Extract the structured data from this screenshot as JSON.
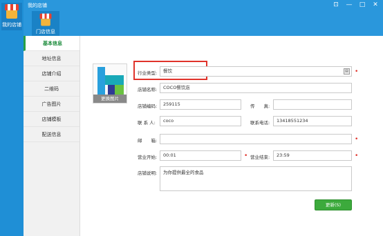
{
  "app": {
    "title": "我的店铺"
  },
  "rail": {
    "label": "我的店铺"
  },
  "window_controls": [
    "⊡",
    "—",
    "□",
    "✕"
  ],
  "tab": {
    "label": "门店信息"
  },
  "nav": {
    "items": [
      {
        "label": "基本信息",
        "active": true
      },
      {
        "label": "地址信息",
        "active": false
      },
      {
        "label": "店铺介绍",
        "active": false
      },
      {
        "label": "二维码",
        "active": false
      },
      {
        "label": "广告图片",
        "active": false
      },
      {
        "label": "店铺模板",
        "active": false
      },
      {
        "label": "配送信息",
        "active": false
      }
    ]
  },
  "logo": {
    "caption": "更换图片"
  },
  "form": {
    "industry": {
      "label": "行业类型:",
      "value": "餐饮"
    },
    "store_name": {
      "label": "店铺名称:",
      "value": "COCO餐饮店"
    },
    "store_code": {
      "label": "店铺编码:",
      "value": "259115"
    },
    "fax": {
      "label": "传　　真:",
      "value": ""
    },
    "contact": {
      "label": "联 系 人:",
      "value": "coco"
    },
    "phone": {
      "label": "联系电话:",
      "value": "13418551234"
    },
    "email": {
      "label": "邮　　箱:",
      "value": ""
    },
    "open_time": {
      "label": "营业开始:",
      "value": "00:01"
    },
    "close_time": {
      "label": "营业结束:",
      "value": "23:59"
    },
    "description": {
      "label": "店铺说明:",
      "value": "为你提供最全的食品"
    }
  },
  "save_button": "更新(S)",
  "colors": {
    "brand_blue": "#2a97dc",
    "accent_green": "#3caa3c",
    "required_red": "#e0322a"
  }
}
